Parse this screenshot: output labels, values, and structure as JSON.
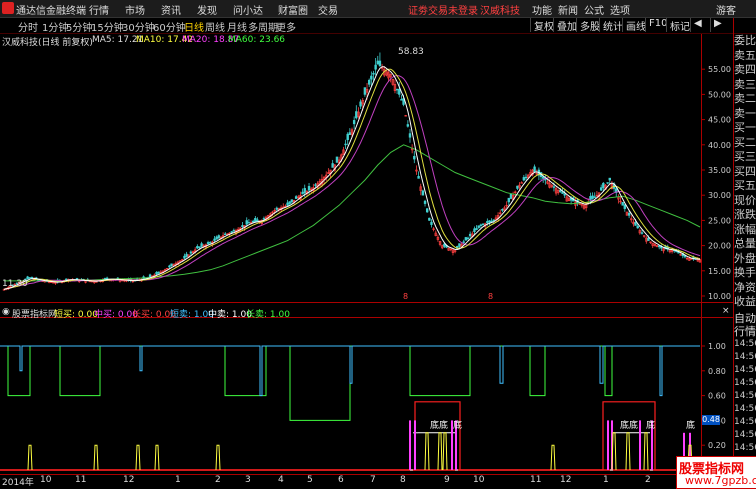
{
  "app": {
    "title": "通达信金融终端"
  },
  "top_menu": [
    "行情",
    "市场",
    "资讯",
    "发现",
    "问小达",
    "财富圈",
    "交易"
  ],
  "login_notice": "证劵交易未登录",
  "stock_tab": "汉威科技",
  "right_menu": [
    "功能",
    "新闻",
    "公式",
    "选项",
    "游客"
  ],
  "periods": [
    "分时",
    "1分钟",
    "5分钟",
    "15分钟",
    "30分钟",
    "60分钟",
    "日线",
    "周线",
    "月线",
    "多周期",
    "更多"
  ],
  "active_period": "日线",
  "right_tools": [
    "复权",
    "叠加",
    "多股",
    "统计",
    "画线",
    "F10",
    "标记"
  ],
  "chart_header": {
    "name": "汉威科技(日线 前复权)",
    "ma5": "MA5: 17.21",
    "ma10": "MA10: 17.42",
    "ma20": "MA20: 18.87",
    "ma60": "MA60: 23.66"
  },
  "price_axis": [
    "55.00",
    "50.00",
    "45.00",
    "40.00",
    "35.00",
    "30.00",
    "25.00",
    "20.00",
    "15.00",
    "10.00"
  ],
  "peak_label": "58.83",
  "low_label": "11.30",
  "indicator": {
    "name": "股票指标网",
    "items": [
      {
        "label": "短买: 0.00",
        "color": "#ffff40"
      },
      {
        "label": "中买: 0.00",
        "color": "#ff40ff"
      },
      {
        "label": "长买: 0.00",
        "color": "#ff4040"
      },
      {
        "label": "短卖: 1.00",
        "color": "#40c0ff"
      },
      {
        "label": "中卖: 1.00",
        "color": "#ffffff"
      },
      {
        "label": "长卖: 1.00",
        "color": "#40ff40"
      }
    ],
    "axis": [
      "1.00",
      "0.80",
      "0.60",
      "0.40",
      "0.20"
    ],
    "current_value": "0.48",
    "tags": [
      "底底",
      "底",
      "底底",
      "底",
      "底"
    ]
  },
  "sidebar_quote": [
    "委比",
    "卖五",
    "卖四",
    "卖三",
    "卖二",
    "卖一",
    "买一",
    "买二",
    "买三",
    "买四",
    "买五",
    "现价",
    "涨跌",
    "涨幅",
    "总量",
    "外盘",
    "换手",
    "净资",
    "收益"
  ],
  "sidebar_trade": [
    "自动",
    "行情",
    "14:56",
    "14:56",
    "14:56",
    "14:56",
    "14:56",
    "14:56",
    "14:56",
    "14:56",
    "14:56"
  ],
  "dates": [
    "2014年",
    "10",
    "11",
    "12",
    "1",
    "2",
    "3",
    "4",
    "5",
    "6",
    "7",
    "8",
    "9",
    "10",
    "11",
    "12",
    "1",
    "2"
  ],
  "watermark": {
    "line1": "股票指标网",
    "line2": "www.7gpzb.com"
  },
  "chart_data": {
    "type": "line",
    "ylim": [
      10,
      60
    ],
    "peak": 58.83,
    "low": 11.3,
    "close": [
      11.3,
      12.5,
      13.6,
      13.0,
      12.7,
      13.3,
      13.1,
      12.9,
      13.4,
      13.2,
      13.0,
      13.5,
      14.5,
      16.0,
      17.5,
      19.5,
      20.5,
      22.0,
      23.0,
      24.5,
      25.0,
      27.0,
      28.0,
      30.0,
      31.5,
      34.0,
      37.0,
      43.0,
      50.0,
      56.0,
      54.0,
      48.0,
      35.0,
      25.0,
      20.0,
      19.0,
      21.5,
      24.0,
      25.0,
      28.0,
      32.0,
      35.0,
      33.0,
      31.0,
      29.0,
      28.0,
      30.0,
      33.0,
      28.0,
      24.0,
      21.0,
      19.5,
      19.0,
      17.5,
      17.2
    ],
    "ma60": [
      13.0,
      13.0,
      13.0,
      13.0,
      13.0,
      13.0,
      13.1,
      13.2,
      13.3,
      13.4,
      13.5,
      13.6,
      13.8,
      14.0,
      14.3,
      14.7,
      15.2,
      16.0,
      17.0,
      18.0,
      19.0,
      20.0,
      21.0,
      22.5,
      24.0,
      26.0,
      28.0,
      30.5,
      33.0,
      36.0,
      38.5,
      40.0,
      39.0,
      37.5,
      36.0,
      34.5,
      33.5,
      32.5,
      31.5,
      30.5,
      30.0,
      29.5,
      28.8,
      28.5,
      28.3,
      28.5,
      29.0,
      29.5,
      29.8,
      29.0,
      28.0,
      27.0,
      26.0,
      25.0,
      23.7
    ]
  }
}
